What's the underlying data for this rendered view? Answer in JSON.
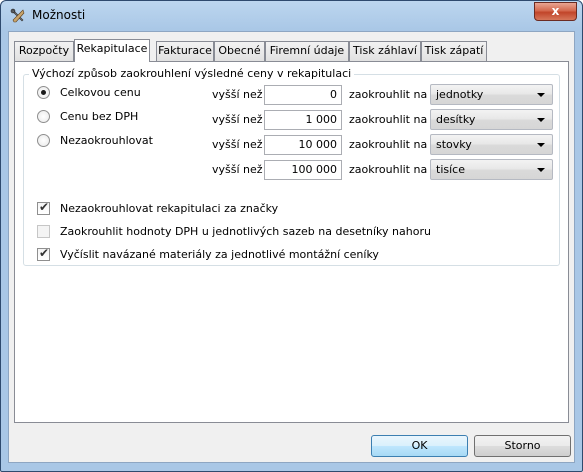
{
  "window": {
    "title": "Možnosti",
    "close_glyph": "x"
  },
  "tabs": [
    {
      "label": "Rozpočty"
    },
    {
      "label": "Rekapitulace"
    },
    {
      "label": "Fakturace"
    },
    {
      "label": "Obecné"
    },
    {
      "label": "Firemní údaje"
    },
    {
      "label": "Tisk záhlaví"
    },
    {
      "label": "Tisk zápatí"
    }
  ],
  "active_tab": "Rekapitulace",
  "rounding_group": {
    "title": "Výchozí způsob zaokrouhlení výsledné ceny v rekapitulaci",
    "options": [
      {
        "label": "Celkovou cenu",
        "checked": true
      },
      {
        "label": "Cenu bez DPH",
        "checked": false
      },
      {
        "label": "Nezaokrouhlovat",
        "checked": false
      }
    ],
    "rows": [
      {
        "higher_label": "vyšší než",
        "value": "0",
        "round_label": "zaokrouhlit na",
        "selected": "jednotky"
      },
      {
        "higher_label": "vyšší než",
        "value": "1 000",
        "round_label": "zaokrouhlit na",
        "selected": "desítky"
      },
      {
        "higher_label": "vyšší než",
        "value": "10 000",
        "round_label": "zaokrouhlit na",
        "selected": "stovky"
      },
      {
        "higher_label": "vyšší než",
        "value": "100 000",
        "round_label": "zaokrouhlit na",
        "selected": "tisíce"
      }
    ],
    "checkboxes": [
      {
        "label": "Nezaokrouhlovat rekapitulaci za značky",
        "checked": true,
        "enabled": true
      },
      {
        "label": "Zaokrouhlit hodnoty DPH u jednotlivých sazeb na desetníky nahoru",
        "checked": false,
        "enabled": false
      },
      {
        "label": "Vyčíslit navázané materiály za jednotlivé montážní ceníky",
        "checked": true,
        "enabled": true
      }
    ]
  },
  "buttons": {
    "ok": "OK",
    "cancel": "Storno"
  },
  "colors": {
    "title_bar": "#bcd6ef",
    "close_button": "#c1452a",
    "ok_button": "#bee6fd"
  }
}
